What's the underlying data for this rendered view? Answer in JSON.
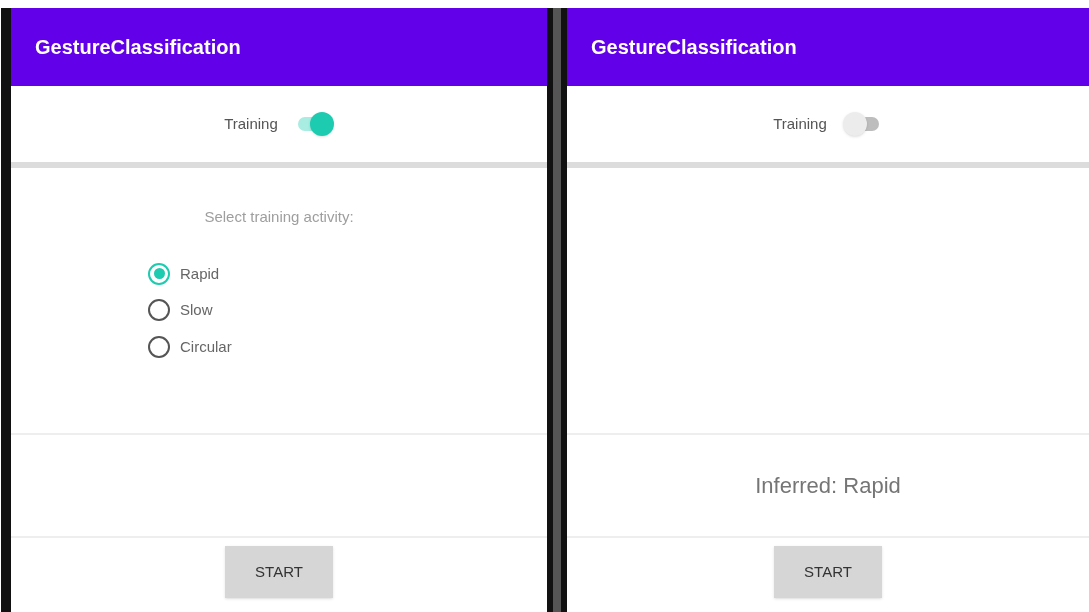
{
  "screens": [
    {
      "title": "GestureClassification",
      "training": {
        "label": "Training",
        "on": true
      },
      "prompt": "Select training activity:",
      "options": [
        {
          "label": "Rapid",
          "selected": true
        },
        {
          "label": "Slow",
          "selected": false
        },
        {
          "label": "Circular",
          "selected": false
        }
      ],
      "button": "START"
    },
    {
      "title": "GestureClassification",
      "training": {
        "label": "Training",
        "on": false
      },
      "result": "Inferred: Rapid",
      "button": "START"
    }
  ]
}
